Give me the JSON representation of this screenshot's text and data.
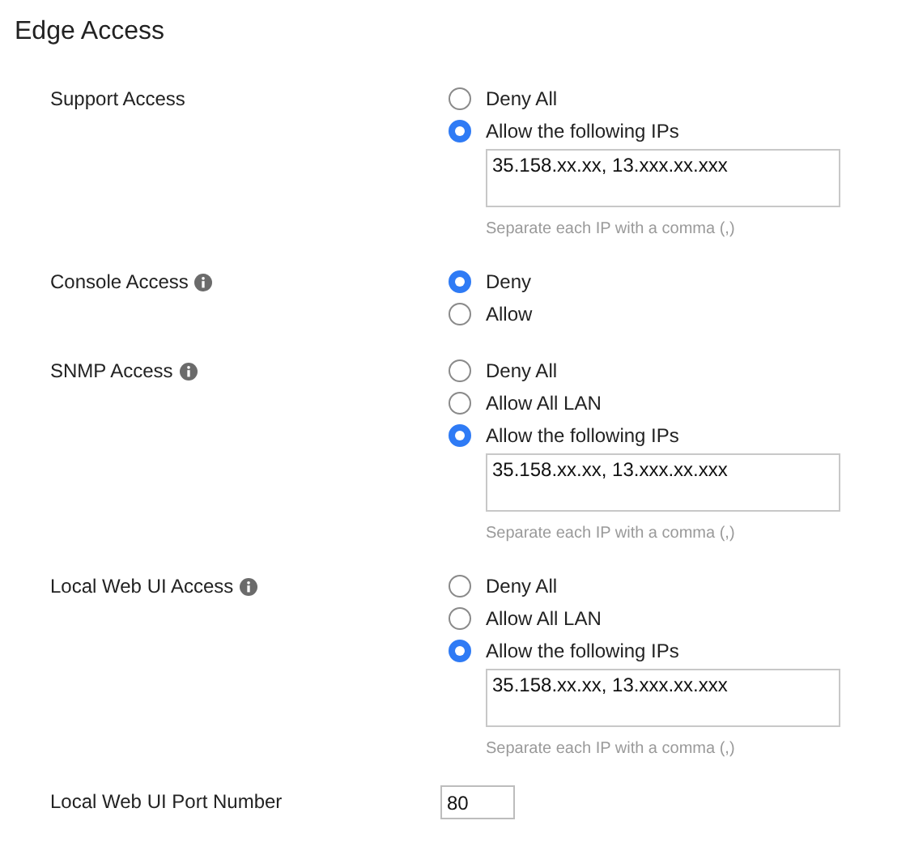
{
  "title": "Edge Access",
  "settings": [
    {
      "kind": "radio",
      "label": "Support Access",
      "info": false,
      "options": [
        {
          "label": "Deny All",
          "selected": false
        },
        {
          "label": "Allow the following IPs",
          "selected": true
        }
      ],
      "ip_field": {
        "value": "35.158.xx.xx, 13.xxx.xx.xxx",
        "hint": "Separate each IP with a comma (,)"
      }
    },
    {
      "kind": "radio",
      "label": "Console Access",
      "info": true,
      "options": [
        {
          "label": "Deny",
          "selected": true
        },
        {
          "label": "Allow",
          "selected": false
        }
      ]
    },
    {
      "kind": "radio",
      "label": "SNMP Access",
      "info": true,
      "options": [
        {
          "label": "Deny All",
          "selected": false
        },
        {
          "label": "Allow All LAN",
          "selected": false
        },
        {
          "label": "Allow the following IPs",
          "selected": true
        }
      ],
      "ip_field": {
        "value": "35.158.xx.xx, 13.xxx.xx.xxx",
        "hint": "Separate each IP with a comma (,)"
      }
    },
    {
      "kind": "radio",
      "label": "Local Web UI Access",
      "info": true,
      "options": [
        {
          "label": "Deny All",
          "selected": false
        },
        {
          "label": "Allow All LAN",
          "selected": false
        },
        {
          "label": "Allow the following IPs",
          "selected": true
        }
      ],
      "ip_field": {
        "value": "35.158.xx.xx, 13.xxx.xx.xxx",
        "hint": "Separate each IP with a comma (,)"
      }
    },
    {
      "kind": "number",
      "label": "Local Web UI Port Number",
      "info": false,
      "value": "80"
    }
  ]
}
